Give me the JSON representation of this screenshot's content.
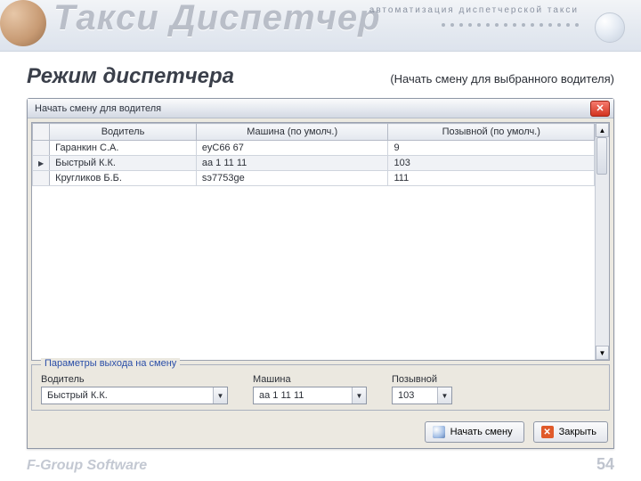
{
  "header": {
    "title": "Такси Диспетчер",
    "subtitle": "автоматизация диспетчерской такси"
  },
  "section": {
    "title": "Режим диспетчера",
    "note": "(Начать смену для выбранного водителя)"
  },
  "dialog": {
    "title": "Начать смену для водителя",
    "columns": {
      "driver": "Водитель",
      "car": "Машина (по умолч.)",
      "callsign": "Позывной (по умолч.)"
    },
    "rows": [
      {
        "driver": "Гаранкин С.А.",
        "car": "еуС66 67",
        "callsign": "9"
      },
      {
        "driver": "Быстрый К.К.",
        "car": "аа 1 11 11",
        "callsign": "103",
        "selected": true
      },
      {
        "driver": "Кругликов Б.Б.",
        "car": "sэ7753ge",
        "callsign": "111"
      }
    ],
    "params": {
      "legend": "Параметры выхода на смену",
      "driver_label": "Водитель",
      "driver_value": "Быстрый К.К.",
      "car_label": "Машина",
      "car_value": "аа 1 11 11",
      "callsign_label": "Позывной",
      "callsign_value": "103"
    },
    "buttons": {
      "start": "Начать смену",
      "close": "Закрыть"
    }
  },
  "footer": {
    "brand": "F-Group Software",
    "page": "54"
  }
}
